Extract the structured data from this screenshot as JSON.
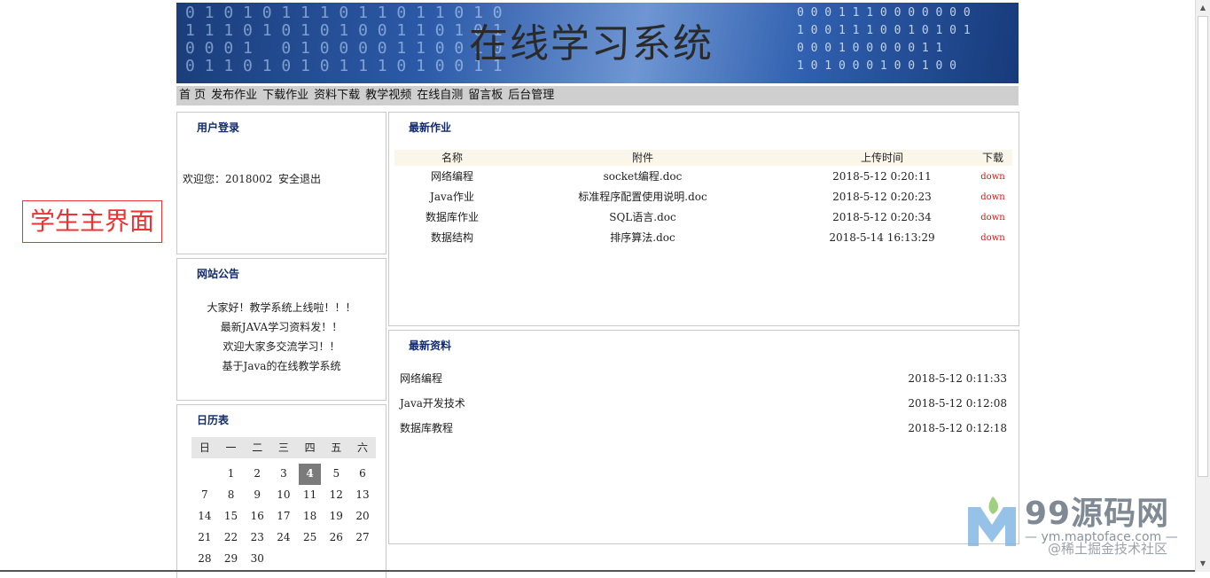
{
  "side_label": "学生主界面",
  "banner": {
    "title": "在线学习系统",
    "bits_left": "0 1 0 1 0 1 1 1 0 1 1 0 1 1 0 1 0\n1 1 1 0 1 0 1 0 1 0 0 1 1 0 1 0 1\n0 0 0 1   0 1 0 0 0 0 1 1 0 0 1 0\n0 1 1 0 1 0 1 0 1 1 1 0 1 0 0 1 1",
    "bits_right": "0 0 0 1 1 1 0 0 0 0 0 0 0\n1 0 0 1 1 1 0 0 1 0 1 0 1\n0 0 0 1 0 0 0 0 0 1 1\n1 0 1 0 0 0 1 0 0 1 0 0"
  },
  "nav": [
    "首 页",
    "发布作业",
    "下载作业",
    "资料下载",
    "教学视频",
    "在线自测",
    "留言板",
    "后台管理"
  ],
  "login": {
    "title": "用户登录",
    "welcome": "欢迎您：2018002",
    "logout": "安全退出"
  },
  "notice": {
    "title": "网站公告",
    "items": [
      "大家好！教学系统上线啦！！！",
      "最新JAVA学习资料发！！",
      "欢迎大家多交流学习！！",
      "基于Java的在线教学系统"
    ]
  },
  "calendar": {
    "title": "日历表",
    "weekdays": [
      "日",
      "一",
      "二",
      "三",
      "四",
      "五",
      "六"
    ],
    "days": [
      "",
      "1",
      "2",
      "3",
      "4",
      "5",
      "6",
      "7",
      "8",
      "9",
      "10",
      "11",
      "12",
      "13",
      "14",
      "15",
      "16",
      "17",
      "18",
      "19",
      "20",
      "21",
      "22",
      "23",
      "24",
      "25",
      "26",
      "27",
      "28",
      "29",
      "30"
    ],
    "today": "4"
  },
  "homework": {
    "title": "最新作业",
    "headers": [
      "名称",
      "附件",
      "上传时间",
      "下载"
    ],
    "rows": [
      {
        "name": "网络编程",
        "file": "socket编程.doc",
        "time": "2018-5-12 0:20:11",
        "action": "down"
      },
      {
        "name": "Java作业",
        "file": "标准程序配置使用说明.doc",
        "time": "2018-5-12 0:20:23",
        "action": "down"
      },
      {
        "name": "数据库作业",
        "file": "SQL语言.doc",
        "time": "2018-5-12 0:20:34",
        "action": "down"
      },
      {
        "name": "数据结构",
        "file": "排序算法.doc",
        "time": "2018-5-14 16:13:29",
        "action": "down"
      }
    ]
  },
  "resources": {
    "title": "最新资料",
    "rows": [
      {
        "name": "网络编程",
        "time": "2018-5-12 0:11:33"
      },
      {
        "name": "Java开发技术",
        "time": "2018-5-12 0:12:08"
      },
      {
        "name": "数据库教程",
        "time": "2018-5-12 0:12:18"
      }
    ]
  },
  "watermark": {
    "brand": "99源码网",
    "url": "— ym.maptoface.com —",
    "credit": "@稀土掘金技术社区"
  },
  "colors": {
    "accent_red": "#e33333",
    "title_blue": "#102a6b",
    "nav_bg": "#cfcfcf",
    "today_bg": "#7b7b7b"
  }
}
